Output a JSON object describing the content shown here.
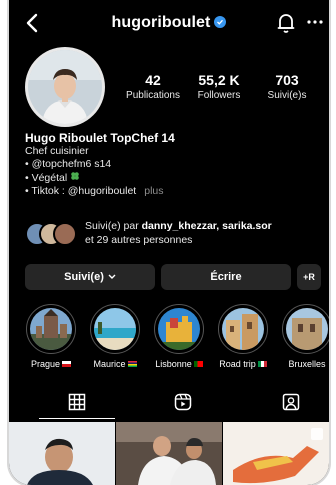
{
  "header": {
    "username": "hugoriboulet",
    "back_icon": "chevron-left-icon",
    "bell_icon": "bell-icon",
    "more_icon": "more-horizontal-icon"
  },
  "stats": [
    {
      "value": "42",
      "label": "Publications"
    },
    {
      "value": "55,2 K",
      "label": "Followers"
    },
    {
      "value": "703",
      "label": "Suivi(e)s"
    }
  ],
  "bio": {
    "name": "Hugo Riboulet TopChef 14",
    "lines": [
      "Chef cuisinier",
      "• @topchefm6 s14",
      "• Végétal",
      "• Tiktok : @hugoriboulet"
    ],
    "more": "plus"
  },
  "followed_by": {
    "prefix": "Suivi(e) par ",
    "names": "danny_khezzar, sarika.sor",
    "suffix": "et 29 autres personnes"
  },
  "actions": {
    "follow": "Suivi(e)",
    "write": "Écrire",
    "add": "+R"
  },
  "highlights": [
    {
      "label": "Prague",
      "flag": "cz"
    },
    {
      "label": "Maurice",
      "flag": "mu"
    },
    {
      "label": "Lisbonne",
      "flag": "pt"
    },
    {
      "label": "Road trip",
      "flag": "it"
    },
    {
      "label": "Bruxelles",
      "flag": "be"
    }
  ],
  "tabs": [
    {
      "icon": "grid-icon"
    },
    {
      "icon": "reels-icon"
    },
    {
      "icon": "tagged-icon"
    }
  ],
  "colors": {
    "background": "#000000",
    "button": "#262626",
    "verified": "#3897f0"
  }
}
